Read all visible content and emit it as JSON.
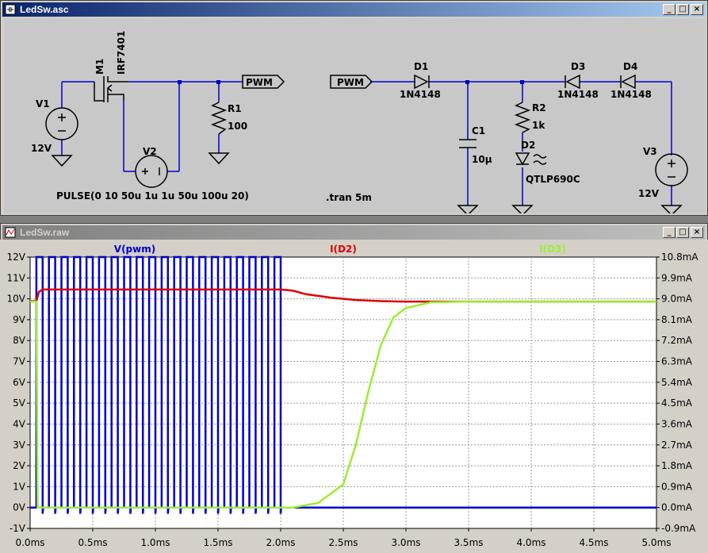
{
  "schematic": {
    "title": "LedSw.asc",
    "buttons": {
      "minimize": "_",
      "maximize": "□",
      "close": "×"
    },
    "labels": {
      "v1": "V1",
      "v1_val": "12V",
      "m1": "M1",
      "m1_val": "IRF7401",
      "r1": "R1",
      "r1_val": "100",
      "v2": "V2",
      "pulse": "PULSE(0 10 50u 1u 1u 50u 100u 20)",
      "pwm_out": "PWM",
      "pwm_in": "PWM",
      "d1": "D1",
      "d1_val": "1N4148",
      "c1": "C1",
      "c1_val": "10µ",
      "r2": "R2",
      "r2_val": "1k",
      "d2": "D2",
      "d2_val": "QTLP690C",
      "d3": "D3",
      "d3_val": "1N4148",
      "d4": "D4",
      "d4_val": "1N4148",
      "v3": "V3",
      "v3_val": "12V",
      "tran": ".tran 5m"
    }
  },
  "waveform": {
    "title": "LedSw.raw",
    "buttons": {
      "minimize": "_",
      "maximize": "□",
      "close": "×"
    }
  },
  "chart_data": {
    "type": "line",
    "traces": [
      "V(pwm)",
      "I(D2)",
      "I(D3)"
    ],
    "x_ticks": [
      "0.0ms",
      "0.5ms",
      "1.0ms",
      "1.5ms",
      "2.0ms",
      "2.5ms",
      "3.0ms",
      "3.5ms",
      "4.0ms",
      "4.5ms",
      "5.0ms"
    ],
    "y_left_ticks": [
      "12V",
      "11V",
      "10V",
      "9V",
      "8V",
      "7V",
      "6V",
      "5V",
      "4V",
      "3V",
      "2V",
      "1V",
      "0V",
      "-1V"
    ],
    "y_right_ticks": [
      "10.8mA",
      "9.9mA",
      "9.0mA",
      "8.1mA",
      "7.2mA",
      "6.3mA",
      "5.4mA",
      "4.5mA",
      "3.6mA",
      "2.7mA",
      "1.8mA",
      "0.9mA",
      "0.0mA",
      "-0.9mA"
    ],
    "xlim_ms": [
      0,
      5
    ],
    "ylim_left_V": [
      -1,
      12
    ],
    "ylim_right_mA": [
      -0.9,
      10.8
    ],
    "colors": {
      "V(pwm)": "#0000cc",
      "I(D2)": "#dd0000",
      "I(D3)": "#99ee33"
    },
    "series": [
      {
        "name": "V(pwm)",
        "pulse": {
          "v_low": 0,
          "v_high": 12,
          "delay_ms": 0.05,
          "width_ms": 0.05,
          "period_ms": 0.1,
          "cycles": 20,
          "undershoot_V": -0.3
        }
      },
      {
        "name": "I(D2)",
        "x_ms": [
          0,
          0.05,
          0.07,
          0.1,
          2.0,
          2.1,
          2.2,
          2.4,
          2.6,
          2.8,
          3.0,
          3.2,
          3.5,
          5.0
        ],
        "y_mA": [
          8.9,
          8.9,
          9.3,
          9.4,
          9.4,
          9.35,
          9.2,
          9.05,
          8.95,
          8.9,
          8.88,
          8.88,
          8.88,
          8.88
        ]
      },
      {
        "name": "I(D3)",
        "x_ms": [
          0,
          0.05,
          0.06,
          0.1,
          2.1,
          2.3,
          2.5,
          2.6,
          2.7,
          2.8,
          2.9,
          3.0,
          3.2,
          3.5,
          5.0
        ],
        "y_mA": [
          8.88,
          8.88,
          0.0,
          0.0,
          0.0,
          0.2,
          1.0,
          2.7,
          5.0,
          7.0,
          8.2,
          8.6,
          8.85,
          8.88,
          8.88
        ]
      }
    ]
  }
}
